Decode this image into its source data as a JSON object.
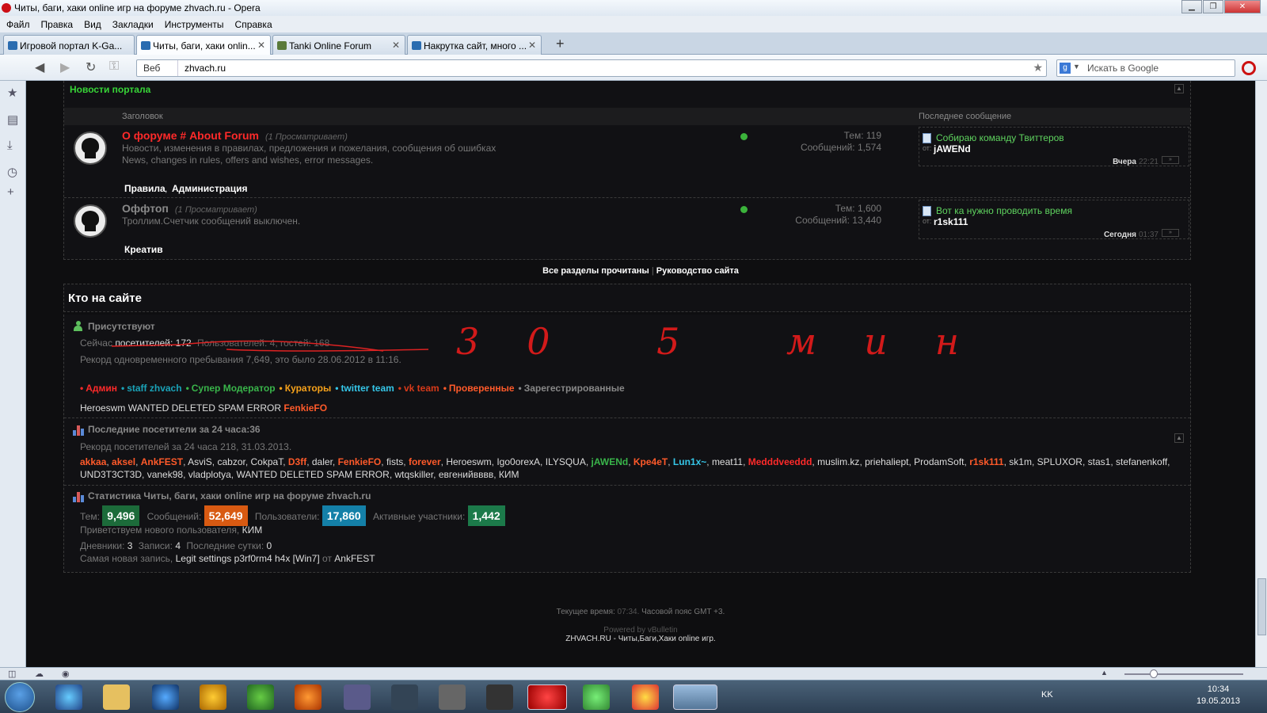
{
  "window": {
    "title": "Читы, баги, хаки online игр на форуме zhvach.ru - Opera"
  },
  "menu": [
    "Файл",
    "Правка",
    "Вид",
    "Закладки",
    "Инструменты",
    "Справка"
  ],
  "tabs": [
    {
      "label": "Игровой портал K-Ga..."
    },
    {
      "label": "Читы, баги, хаки onlin..."
    },
    {
      "label": "Tanki Online Forum"
    },
    {
      "label": "Накрутка сайт, много ..."
    }
  ],
  "address": {
    "mode": "Веб",
    "url": "zhvach.ru",
    "search_placeholder": "Искать в Google"
  },
  "forum": {
    "section_title": "Новости портала",
    "col_title": "Заголовок",
    "col_last": "Последнее сообщение",
    "rows": [
      {
        "title": "О форуме # About Forum",
        "viewing": "(1 Просматривает)",
        "desc1": "Новости, изменения в правилах, предложения и пожелания, сообщения об ошибках",
        "desc2": "News, changes in rules, offers and wishes, error messages.",
        "topics": "Тем: 119",
        "posts": "Сообщений: 1,574",
        "sub1": "Правила",
        "sub2": "Администрация",
        "last_title": "Собираю команду Твиттеров",
        "last_by": "от:",
        "last_user": "jAWENd",
        "last_day": "Вчера",
        "last_time": "22:21"
      },
      {
        "title": "Оффтоп",
        "viewing": "(1 Просматривает)",
        "desc1": "Троллим.Счетчик сообщений выключен.",
        "topics": "Тем: 1,600",
        "posts": "Сообщений: 13,440",
        "sub1": "Креатив",
        "last_title": "Вот ка нужно проводить время",
        "last_by": "от:",
        "last_user": "r1sk111",
        "last_day": "Сегодня",
        "last_time": "01:37"
      }
    ],
    "links": {
      "read_all": "Все разделы прочитаны",
      "sep": "|",
      "guide": "Руководство сайта"
    }
  },
  "who": {
    "title": "Кто на сайте",
    "present": "Присутствуют",
    "now_label": "Сейчас",
    "now_visitors": "посетителей: 172",
    "now_rest": "Пользователей: 4, гостей: 168",
    "record": "Рекорд одновременного пребывания 7,649, это было 28.06.2012 в 11:16.",
    "handwriting": "30 5 мин",
    "legend": [
      {
        "label": "Админ",
        "color": "#ff2a2a"
      },
      {
        "label": "staff zhvach",
        "color": "#1aa3b8"
      },
      {
        "label": "Супер Модератор",
        "color": "#39b54a"
      },
      {
        "label": "Кураторы",
        "color": "#f7a21b"
      },
      {
        "label": "twitter team",
        "color": "#35c6e8"
      },
      {
        "label": "vk team",
        "color": "#d83a1a"
      },
      {
        "label": "Проверенные",
        "color": "#ff5a2a"
      },
      {
        "label": "Зарегестрированные",
        "color": "#888888"
      }
    ],
    "online_users": [
      {
        "name": "Heroeswm",
        "color": "#dddddd"
      },
      {
        "name": "WANTED DELETED SPAM ERROR",
        "color": "#dddddd"
      },
      {
        "name": "FenkieFO",
        "color": "#ff5a2a"
      }
    ]
  },
  "last24": {
    "title": "Последние посетители за 24 часа:36",
    "record": "Рекорд посетителей за 24 часа 218, 31.03.2013.",
    "users": [
      {
        "name": "akkaa",
        "color": "#ff5a2a"
      },
      {
        "name": "aksel",
        "color": "#ff5a2a"
      },
      {
        "name": "AnkFEST",
        "color": "#ff5a2a"
      },
      {
        "name": "AsviS",
        "color": "#dddddd"
      },
      {
        "name": "cabzor",
        "color": "#dddddd"
      },
      {
        "name": "CokpaT",
        "color": "#dddddd"
      },
      {
        "name": "D3ff",
        "color": "#ff5a2a"
      },
      {
        "name": "daler",
        "color": "#dddddd"
      },
      {
        "name": "FenkieFO",
        "color": "#ff5a2a"
      },
      {
        "name": "fists",
        "color": "#dddddd"
      },
      {
        "name": "forever",
        "color": "#ff5a2a"
      },
      {
        "name": "Heroeswm",
        "color": "#dddddd"
      },
      {
        "name": "Igo0orexA",
        "color": "#dddddd"
      },
      {
        "name": "ILYSQUA",
        "color": "#dddddd"
      },
      {
        "name": "jAWENd",
        "color": "#39b54a"
      },
      {
        "name": "Kpe4eT",
        "color": "#ff5a2a"
      },
      {
        "name": "Lun1x~",
        "color": "#35c6e8"
      },
      {
        "name": "meat11",
        "color": "#dddddd"
      },
      {
        "name": "Medddveeddd",
        "color": "#ff2a2a"
      },
      {
        "name": "muslim.kz",
        "color": "#dddddd"
      },
      {
        "name": "priehaliept",
        "color": "#dddddd"
      },
      {
        "name": "ProdamSoft",
        "color": "#dddddd"
      },
      {
        "name": "r1sk111",
        "color": "#ff5a2a"
      },
      {
        "name": "sk1m",
        "color": "#dddddd"
      },
      {
        "name": "SPLUXOR",
        "color": "#dddddd"
      },
      {
        "name": "stas1",
        "color": "#dddddd"
      },
      {
        "name": "stefanenkoff",
        "color": "#dddddd"
      },
      {
        "name": "UND3T3CT3D",
        "color": "#dddddd"
      },
      {
        "name": "vanek98",
        "color": "#dddddd"
      },
      {
        "name": "vladplotya",
        "color": "#dddddd"
      },
      {
        "name": "WANTED DELETED SPAM ERROR",
        "color": "#dddddd"
      },
      {
        "name": "wtqskiller",
        "color": "#dddddd"
      },
      {
        "name": "евгенийвввв",
        "color": "#dddddd"
      },
      {
        "name": "КИМ",
        "color": "#dddddd"
      }
    ]
  },
  "stats": {
    "title": "Статистика Читы, баги, хаки online игр на форуме zhvach.ru",
    "topics_label": "Тем:",
    "topics": "9,496",
    "topics_color": "#1c6b3a",
    "posts_label": "Сообщений:",
    "posts": "52,649",
    "posts_color": "#d85a12",
    "users_label": "Пользователи:",
    "users": "17,860",
    "users_color": "#1480a8",
    "active_label": "Активные участники:",
    "active": "1,442",
    "active_color": "#1c7a4a",
    "welcome": "Приветствуем нового пользователя,",
    "newest": "КИМ",
    "diaries_label": "Дневники:",
    "diaries": "3",
    "entries_label": "Записи:",
    "entries": "4",
    "lastday_label": "Последние сутки:",
    "lastday": "0",
    "newest_entry_label": "Самая новая запись,",
    "newest_entry": "Legit settings p3rf0rm4 h4x [Win7]",
    "by": "от",
    "author": "AnkFEST"
  },
  "footer": {
    "time_label": "Текущее время:",
    "time": "07:34.",
    "tz": "Часовой пояс GMT +3.",
    "powered": "Powered by vBulletin",
    "copyright": "ZHVACH.RU - Читы,Баги,Хаки online игр."
  },
  "taskbar": {
    "lang": "KK",
    "time": "10:34",
    "date": "19.05.2013"
  }
}
